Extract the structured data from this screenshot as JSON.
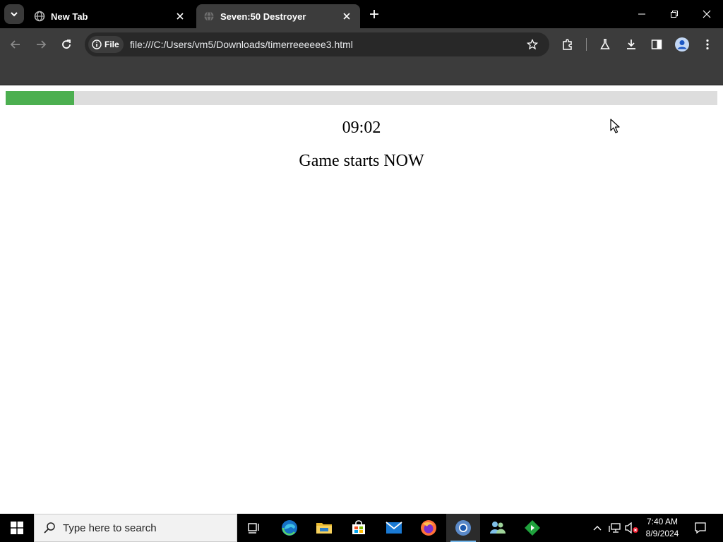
{
  "browser": {
    "tabs": [
      {
        "title": "New Tab",
        "favicon": "globe-icon",
        "active": false
      },
      {
        "title": "Seven:50 Destroyer",
        "favicon": "globe-icon",
        "active": true
      }
    ],
    "address": {
      "chip_label": "File",
      "url": "file:///C:/Users/vm5/Downloads/timerreeeeee3.html"
    }
  },
  "page": {
    "progress_percent": 9.6,
    "progress_color": "#4caf50",
    "track_color": "#dddddd",
    "timer": "09:02",
    "message": "Game starts NOW"
  },
  "taskbar": {
    "search_placeholder": "Type here to search",
    "apps": [
      "task-view-icon",
      "edge-icon",
      "file-explorer-icon",
      "store-icon",
      "mail-icon",
      "firefox-icon",
      "chrome-icon",
      "people-icon",
      "app-green-icon"
    ],
    "clock": {
      "time": "7:40 AM",
      "date": "8/9/2024"
    }
  }
}
